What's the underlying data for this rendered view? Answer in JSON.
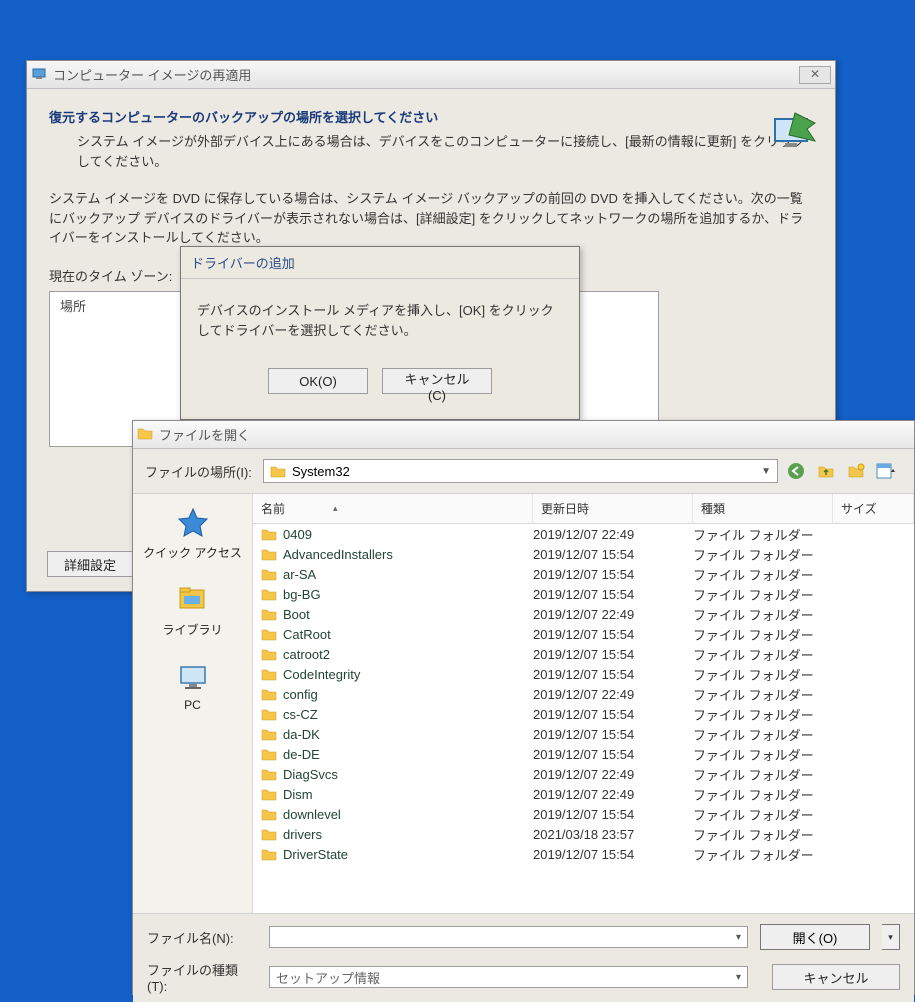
{
  "reimage": {
    "title": "コンピューター イメージの再適用",
    "heading": "復元するコンピューターのバックアップの場所を選択してください",
    "sub1": "システム イメージが外部デバイス上にある場合は、デバイスをこのコンピューターに接続し、[最新の情報に更新] をクリックしてください。",
    "para2": "システム イメージを DVD に保存している場合は、システム イメージ バックアップの前回の DVD を挿入してください。次の一覧にバックアップ デバイスのドライバーが表示されない場合は、[詳細設定] をクリックしてネットワークの場所を追加するか、ドライバーをインストールしてください。",
    "tz_label": "現在のタイム ゾーン:",
    "column_location": "場所",
    "advanced_btn": "詳細設定"
  },
  "adddrv": {
    "title": "ドライバーの追加",
    "message": "デバイスのインストール メディアを挿入し、[OK] をクリックしてドライバーを選択してください。",
    "ok": "OK(O)",
    "cancel": "キャンセル(C)"
  },
  "fileopen": {
    "title": "ファイルを開く",
    "location_label": "ファイルの場所(I):",
    "location_value": "System32",
    "places": {
      "quick": "クイック アクセス",
      "library": "ライブラリ",
      "pc": "PC"
    },
    "columns": {
      "name": "名前",
      "date": "更新日時",
      "type": "種類",
      "size": "サイズ"
    },
    "type_folder": "ファイル フォルダー",
    "rows": [
      {
        "name": "0409",
        "date": "2019/12/07 22:49"
      },
      {
        "name": "AdvancedInstallers",
        "date": "2019/12/07 15:54"
      },
      {
        "name": "ar-SA",
        "date": "2019/12/07 15:54"
      },
      {
        "name": "bg-BG",
        "date": "2019/12/07 15:54"
      },
      {
        "name": "Boot",
        "date": "2019/12/07 22:49"
      },
      {
        "name": "CatRoot",
        "date": "2019/12/07 15:54"
      },
      {
        "name": "catroot2",
        "date": "2019/12/07 15:54"
      },
      {
        "name": "CodeIntegrity",
        "date": "2019/12/07 15:54"
      },
      {
        "name": "config",
        "date": "2019/12/07 22:49"
      },
      {
        "name": "cs-CZ",
        "date": "2019/12/07 15:54"
      },
      {
        "name": "da-DK",
        "date": "2019/12/07 15:54"
      },
      {
        "name": "de-DE",
        "date": "2019/12/07 15:54"
      },
      {
        "name": "DiagSvcs",
        "date": "2019/12/07 22:49"
      },
      {
        "name": "Dism",
        "date": "2019/12/07 22:49"
      },
      {
        "name": "downlevel",
        "date": "2019/12/07 15:54"
      },
      {
        "name": "drivers",
        "date": "2021/03/18 23:57"
      },
      {
        "name": "DriverState",
        "date": "2019/12/07 15:54"
      }
    ],
    "filename_label": "ファイル名(N):",
    "filetype_label": "ファイルの種類(T):",
    "filetype_value": "セットアップ情報",
    "open_btn": "開く(O)",
    "cancel_btn": "キャンセル"
  }
}
